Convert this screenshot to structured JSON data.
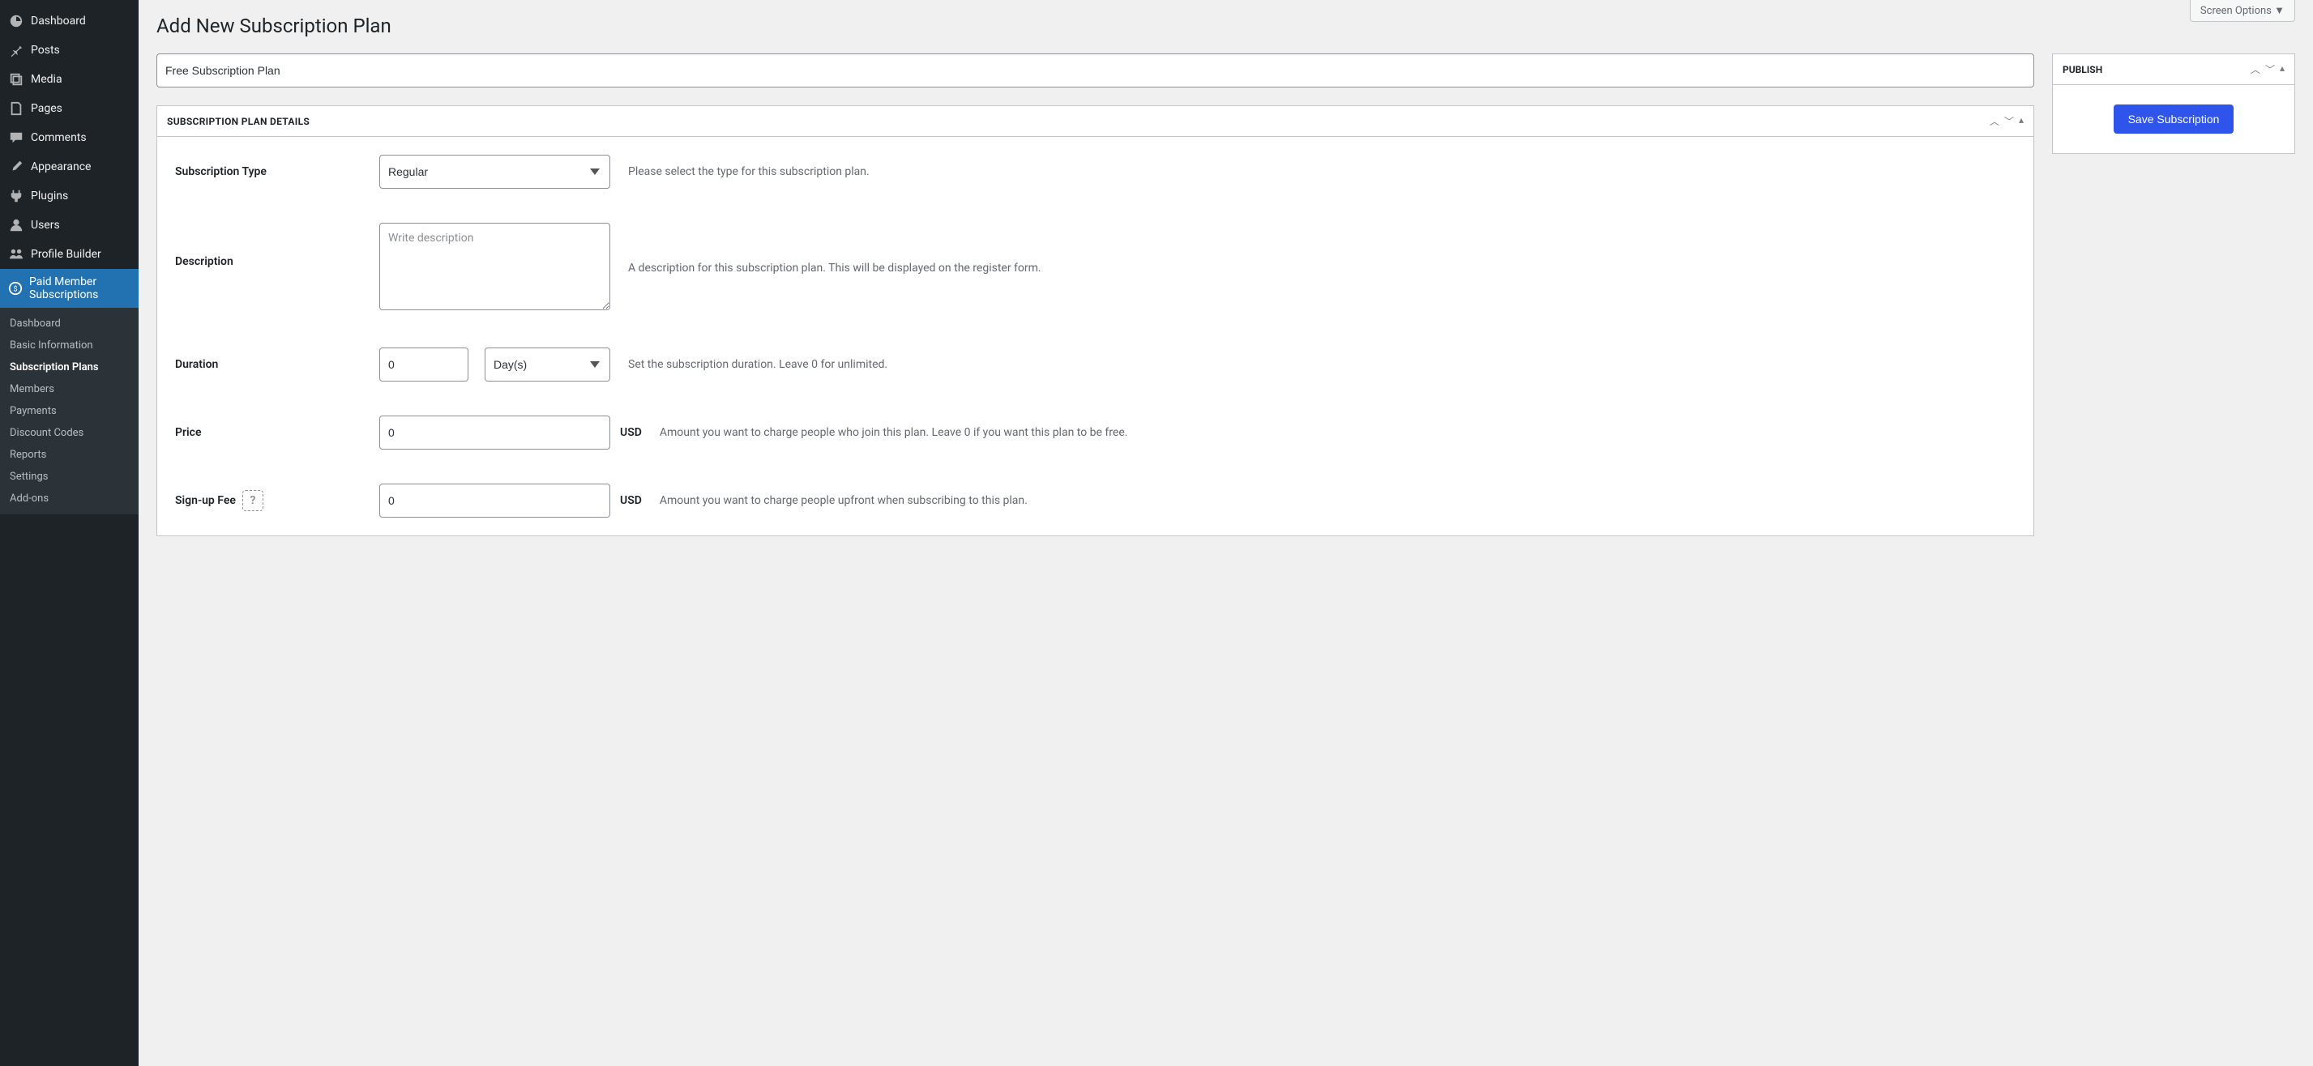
{
  "screen_options_label": "Screen Options",
  "page_title": "Add New Subscription Plan",
  "title_input_value": "Free Subscription Plan",
  "sidebar": {
    "items": [
      {
        "label": "Dashboard"
      },
      {
        "label": "Posts"
      },
      {
        "label": "Media"
      },
      {
        "label": "Pages"
      },
      {
        "label": "Comments"
      },
      {
        "label": "Appearance"
      },
      {
        "label": "Plugins"
      },
      {
        "label": "Users"
      },
      {
        "label": "Profile Builder"
      },
      {
        "label": "Paid Member Subscriptions"
      }
    ],
    "submenu": [
      {
        "label": "Dashboard"
      },
      {
        "label": "Basic Information"
      },
      {
        "label": "Subscription Plans"
      },
      {
        "label": "Members"
      },
      {
        "label": "Payments"
      },
      {
        "label": "Discount Codes"
      },
      {
        "label": "Reports"
      },
      {
        "label": "Settings"
      },
      {
        "label": "Add-ons"
      }
    ]
  },
  "details_panel": {
    "title": "Subscription Plan Details",
    "fields": {
      "subscription_type": {
        "label": "Subscription Type",
        "value": "Regular",
        "hint": "Please select the type for this subscription plan."
      },
      "description": {
        "label": "Description",
        "placeholder": "Write description",
        "hint": "A description for this subscription plan. This will be displayed on the register form."
      },
      "duration": {
        "label": "Duration",
        "value": "0",
        "unit": "Day(s)",
        "hint": "Set the subscription duration. Leave 0 for unlimited."
      },
      "price": {
        "label": "Price",
        "value": "0",
        "currency": "USD",
        "hint": "Amount you want to charge people who join this plan. Leave 0 if you want this plan to be free."
      },
      "signup_fee": {
        "label": "Sign-up Fee",
        "value": "0",
        "currency": "USD",
        "hint": "Amount you want to charge people upfront when subscribing to this plan."
      }
    }
  },
  "publish_panel": {
    "title": "Publish",
    "button": "Save Subscription"
  }
}
